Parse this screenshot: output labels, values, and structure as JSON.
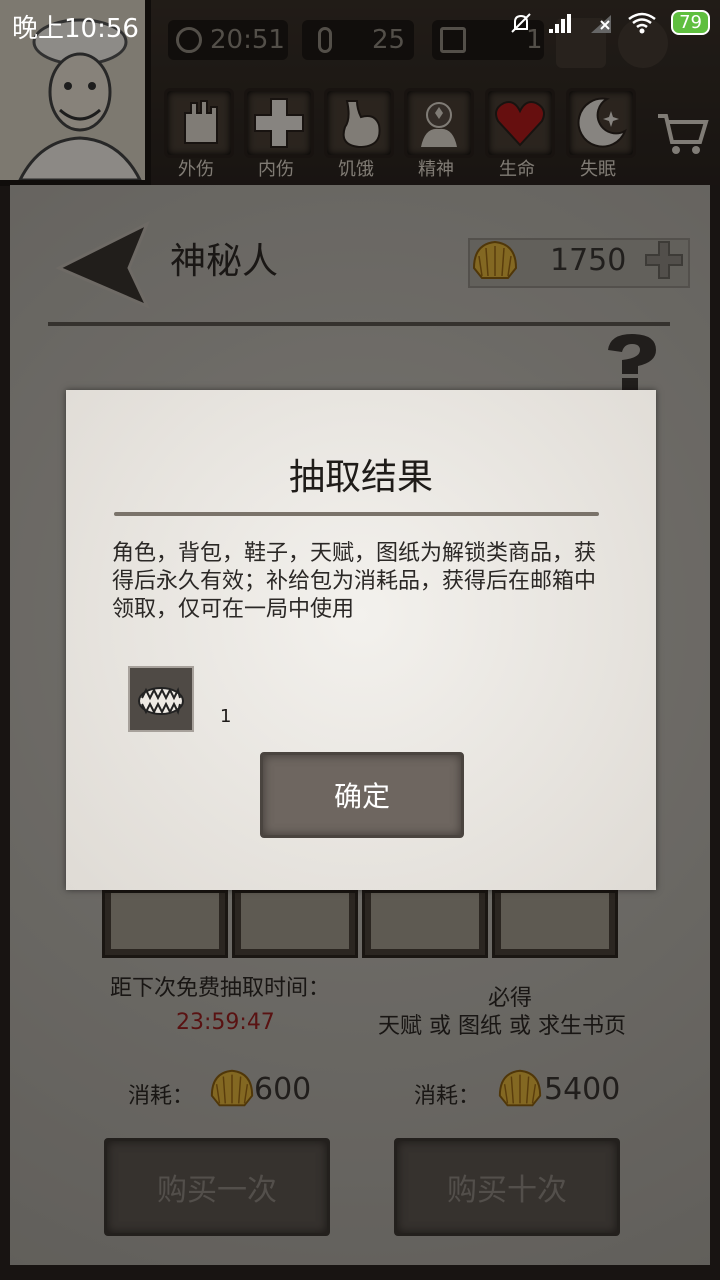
{
  "status": {
    "time": "晚上10:56",
    "battery": "79"
  },
  "header": {
    "stats": [
      {
        "icon": "clock-icon",
        "value": "20:51"
      },
      {
        "icon": "thermometer-icon",
        "value": "25"
      },
      {
        "icon": "calendar-icon",
        "value": "1"
      }
    ],
    "buffs": [
      {
        "icon": "bandaged-hand-icon",
        "label": "外伤"
      },
      {
        "icon": "medical-cross-icon",
        "label": "内伤"
      },
      {
        "icon": "stomach-icon",
        "label": "饥饿"
      },
      {
        "icon": "brain-stars-icon",
        "label": "精神"
      },
      {
        "icon": "heart-icon",
        "label": "生命"
      },
      {
        "icon": "moon-star-icon",
        "label": "失眠"
      }
    ]
  },
  "page": {
    "title": "神秘人",
    "coins": "1750"
  },
  "modal": {
    "title": "抽取结果",
    "text": "角色，背包，鞋子，天赋，图纸为解锁类商品，获得后永久有效；补给包为消耗品，获得后在邮箱中领取，仅可在一局中使用",
    "item_icon": "bear-trap-icon",
    "item_count": "1",
    "confirm_label": "确定"
  },
  "draw": {
    "timer_label": "距下次免费抽取时间：",
    "timer_value": "23:59:47",
    "guarantee_title": "必得",
    "guarantee_sub": "天赋 或 图纸 或 求生书页",
    "cost_label": "消耗：",
    "single_cost": "600",
    "ten_cost": "5400",
    "buy_one_label": "购买一次",
    "buy_ten_label": "购买十次"
  },
  "colors": {
    "timer": "#9a2020",
    "heart": "#b01a1a"
  }
}
